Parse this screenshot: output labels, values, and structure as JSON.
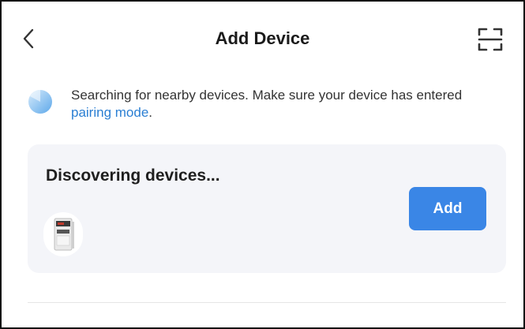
{
  "header": {
    "title": "Add Device",
    "back_icon": "chevron-left-icon",
    "scan_icon": "scan-icon"
  },
  "search": {
    "text": "Searching for nearby devices. Make sure your device has entered ",
    "link": "pairing mode",
    "suffix": ".",
    "indicator_icon": "searching-spinner-icon"
  },
  "card": {
    "title": "Discovering devices...",
    "add_label": "Add",
    "device_icon": "device-thumbnail-icon"
  },
  "colors": {
    "accent": "#3a86e6",
    "link": "#2b7fd3",
    "card_bg": "#f4f5f9",
    "text_primary": "#1b1b1b",
    "text_secondary": "#333333"
  }
}
